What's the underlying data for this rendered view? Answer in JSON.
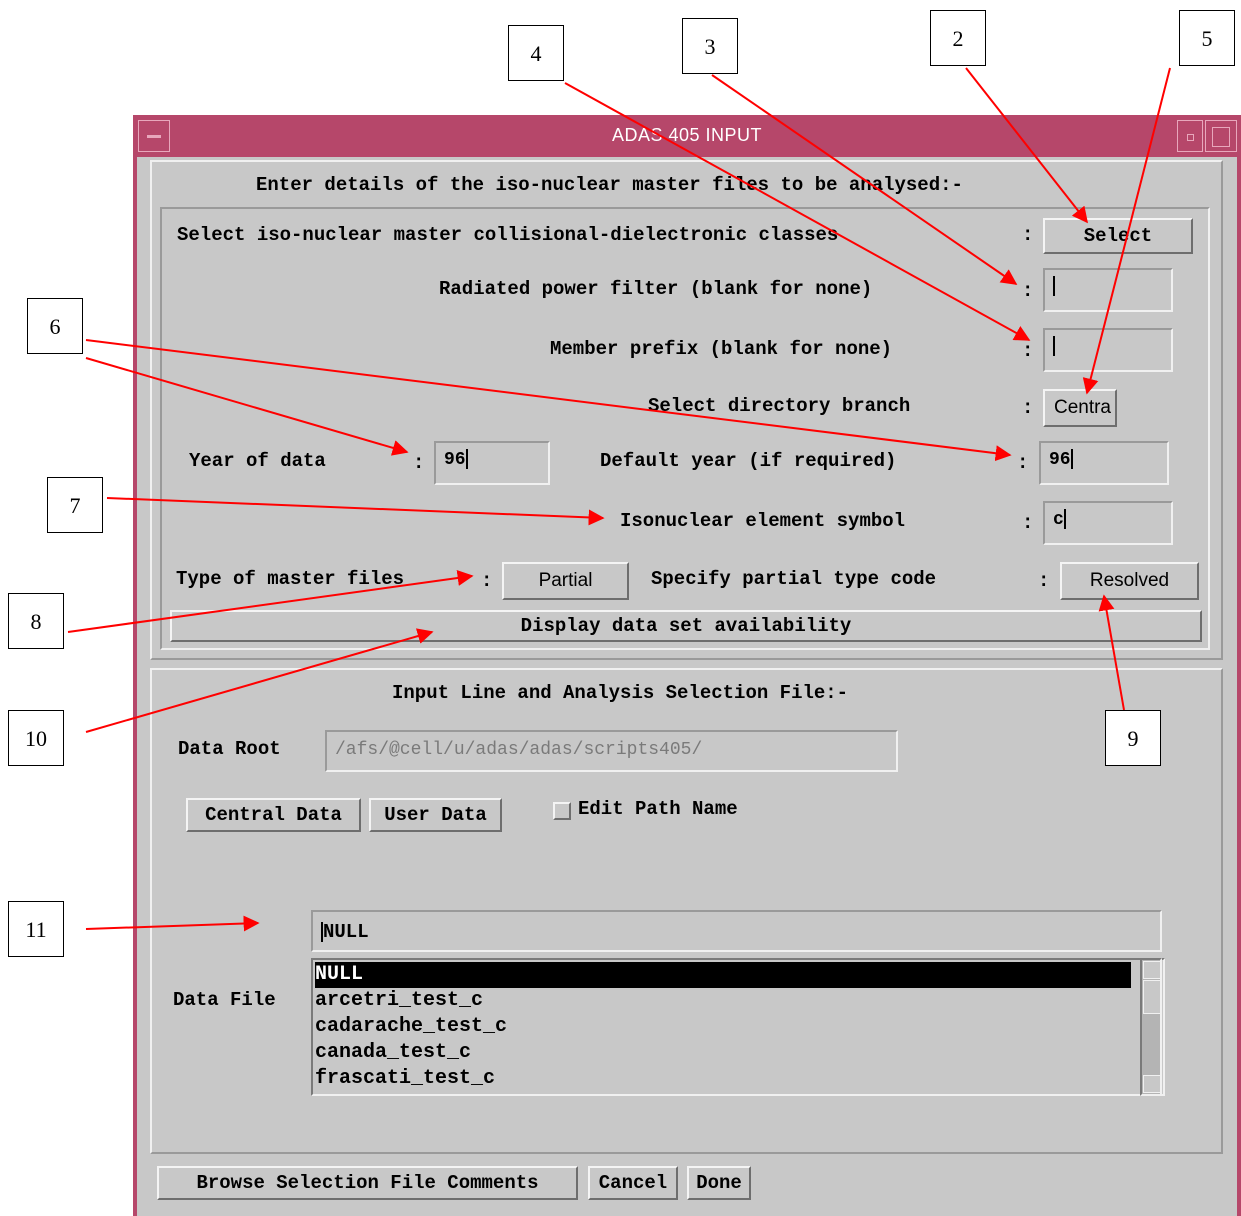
{
  "window": {
    "title": "ADAS 405 INPUT"
  },
  "master_section": {
    "heading": "Enter details of the iso-nuclear master files to be analysed:-",
    "classes_label": "Select iso-nuclear master collisional-dielectronic classes",
    "classes_button": "Select",
    "power_filter_label": "Radiated power filter (blank for none)",
    "power_filter_value": "",
    "member_prefix_label": "Member prefix (blank for none)",
    "member_prefix_value": "",
    "branch_label": "Select directory branch",
    "branch_button": "Centra",
    "year_label": "Year of data",
    "year_value": "96",
    "default_year_label": "Default year (if required)",
    "default_year_value": "96",
    "element_label": "Isonuclear element symbol",
    "element_value": "c",
    "type_label": "Type of master files",
    "type_button": "Partial",
    "partial_label": "Specify partial type code",
    "partial_button": "Resolved",
    "availability_button": "Display data set availability",
    "colon": ":"
  },
  "input_section": {
    "heading": "Input Line and Analysis Selection File:-",
    "data_root_label": "Data Root",
    "data_root_value": "/afs/@cell/u/adas/adas/scripts405/",
    "central_button": "Central Data",
    "user_button": "User Data",
    "edit_path_label": "Edit Path Name",
    "file_value": "NULL",
    "data_file_label": "Data File",
    "files": [
      "NULL",
      "arcetri_test_c",
      "cadarache_test_c",
      "canada_test_c",
      "frascati_test_c"
    ]
  },
  "footer": {
    "browse_button": "Browse Selection File Comments",
    "cancel_button": "Cancel",
    "done_button": "Done"
  },
  "callouts": [
    "2",
    "3",
    "4",
    "5",
    "6",
    "7",
    "8",
    "9",
    "10",
    "11"
  ],
  "colors": {
    "titlebar": "#b6476a",
    "panel": "#c8c8c8",
    "arrow": "#ff0000"
  }
}
